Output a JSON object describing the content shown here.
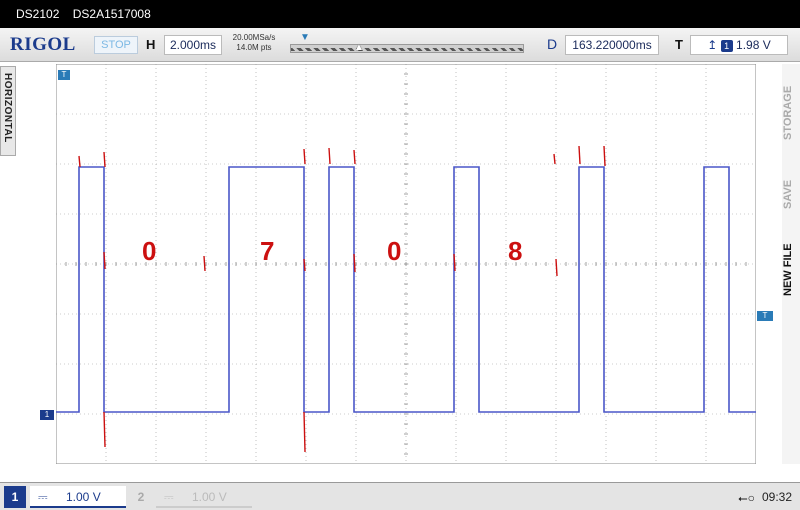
{
  "title_bar": {
    "model": "DS2102",
    "serial": "DS2A1517008"
  },
  "top_bar": {
    "brand": "RIGOL",
    "run_status": "STOP",
    "horizontal_label": "H",
    "timebase": "2.000ms",
    "sample_rate": "20.00MSa/s",
    "memory_depth": "14.0M pts",
    "delay_label": "D",
    "delay_value": "163.220000ms",
    "trigger_label": "T",
    "trigger_source": "1",
    "trigger_level": "1.98 V"
  },
  "side_tab": {
    "label": "HORIZONTAL"
  },
  "right_menu": {
    "items": [
      "STORAGE",
      "SAVE",
      "NEW FILE"
    ]
  },
  "markers": {
    "channel1": "1",
    "trigger": "T",
    "trigger_top": "T"
  },
  "annotations": [
    "0",
    "7",
    "0",
    "8"
  ],
  "colors": {
    "trace": "#4a56c8",
    "annotation": "#cc1010",
    "grid": "#9a9a9a",
    "accent": "#1b3b8c"
  },
  "bottom_bar": {
    "channels": [
      {
        "number": "1",
        "coupling": "⎓",
        "scale": "1.00 V",
        "active": true
      },
      {
        "number": "2",
        "coupling": "⎓",
        "scale": "1.00 V",
        "active": false
      }
    ],
    "usb_icon": "usb-icon",
    "time": "09:32"
  }
}
